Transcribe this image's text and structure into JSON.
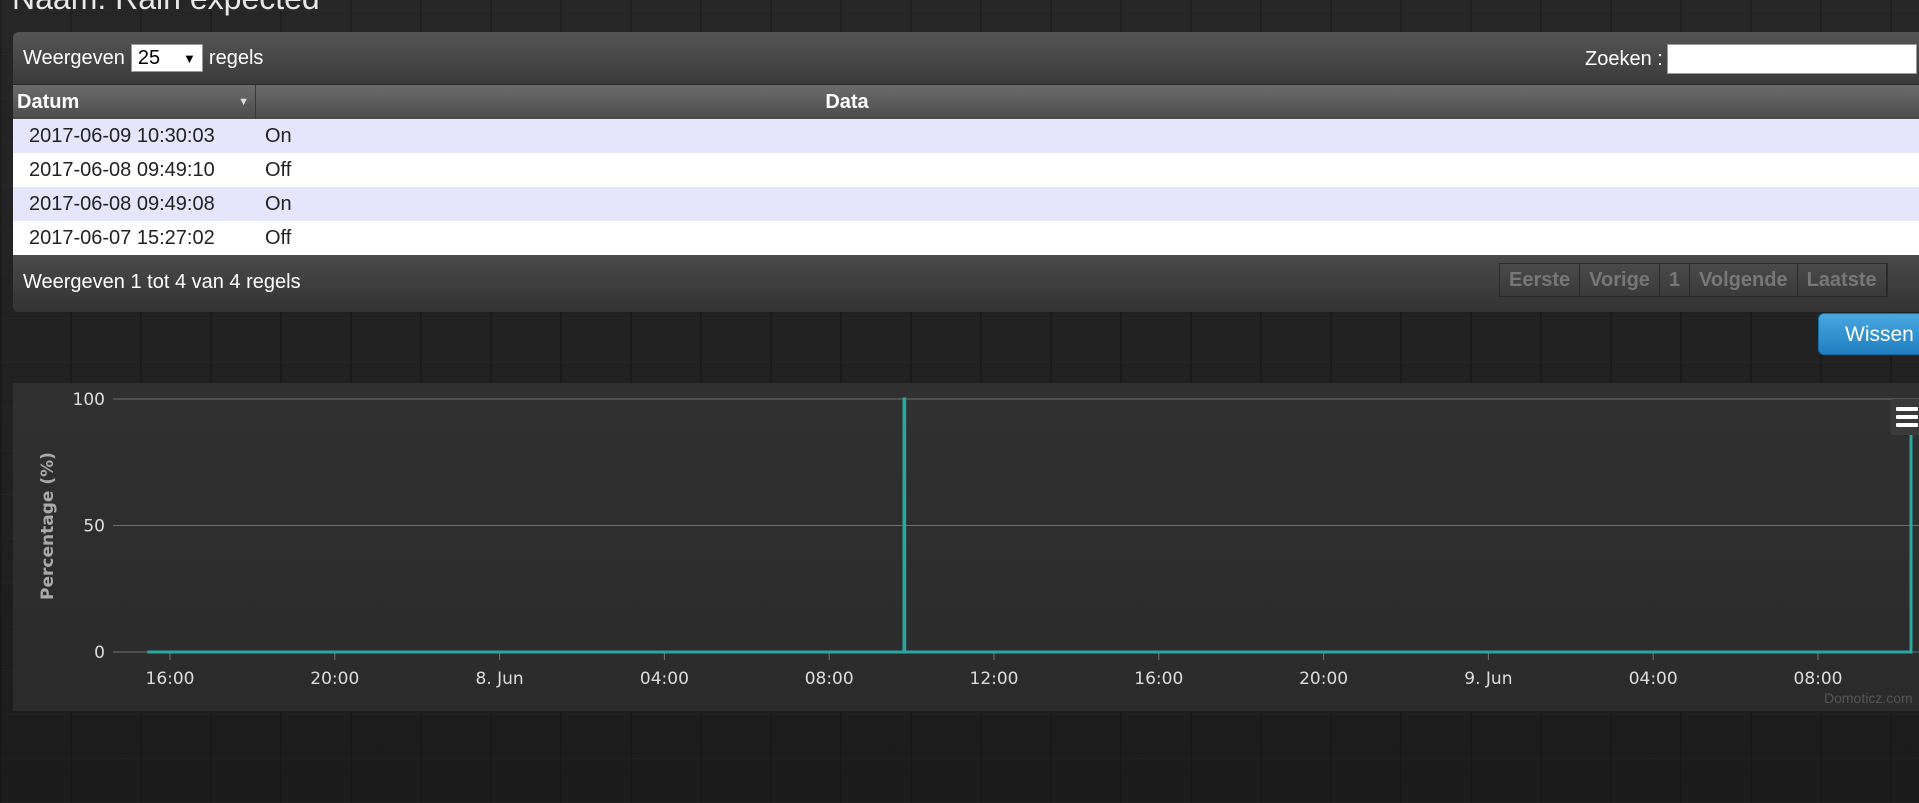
{
  "page": {
    "title": "Naam: Rain expected"
  },
  "table": {
    "length_prefix": "Weergeven",
    "length_value": "25",
    "length_suffix": "regels",
    "search_label": "Zoeken :",
    "search_value": "",
    "columns": [
      "Datum",
      "Data"
    ],
    "rows": [
      {
        "datum": "2017-06-09 10:30:03",
        "data": "On"
      },
      {
        "datum": "2017-06-08 09:49:10",
        "data": "Off"
      },
      {
        "datum": "2017-06-08 09:49:08",
        "data": "On"
      },
      {
        "datum": "2017-06-07 15:27:02",
        "data": "Off"
      }
    ],
    "info": "Weergeven 1 tot 4 van 4 regels",
    "pagination": [
      "Eerste",
      "Vorige",
      "1",
      "Volgende",
      "Laatste"
    ]
  },
  "actions": {
    "clear_label": "Wissen"
  },
  "chart": {
    "credits": "Domoticz.com"
  },
  "chart_data": {
    "type": "line",
    "title": "",
    "ylabel": "Percentage (%)",
    "xlabel": "",
    "ylim": [
      0,
      100
    ],
    "yticks": [
      0,
      50,
      100
    ],
    "xticks": [
      "16:00",
      "20:00",
      "8. Jun",
      "04:00",
      "08:00",
      "12:00",
      "16:00",
      "20:00",
      "9. Jun",
      "04:00",
      "08:00"
    ],
    "x_start": "2017-06-07 15:27",
    "x_end": "2017-06-09 10:30",
    "grid": true,
    "legend": "none",
    "color": "#2ba6a0",
    "series": [
      {
        "x": [
          "2017-06-07 15:27",
          "2017-06-08 09:49",
          "2017-06-08 09:49",
          "2017-06-08 09:50",
          "2017-06-08 09:50",
          "2017-06-09 10:29",
          "2017-06-09 10:30"
        ],
        "values": [
          0,
          0,
          100,
          100,
          0,
          0,
          86
        ]
      }
    ]
  }
}
